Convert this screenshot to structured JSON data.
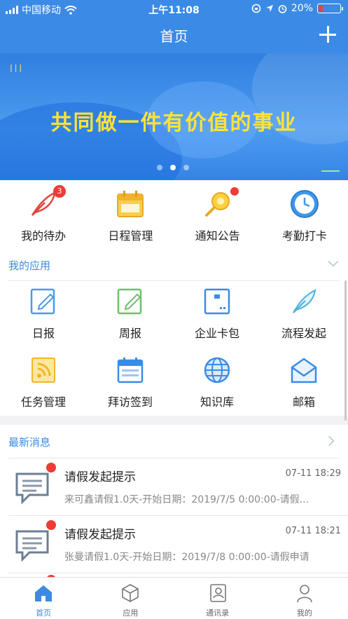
{
  "status_bar": {
    "carrier": "中国移动",
    "time": "上午11:08",
    "battery": "20%",
    "battery_level": 0.2
  },
  "header": {
    "title": "首页",
    "add_icon": "plus-icon"
  },
  "banner": {
    "mark": "||| ",
    "slogan": "共同做一件有价值的事业",
    "page_count": 3,
    "active_page": 2
  },
  "shortcuts": [
    {
      "label": "我的待办",
      "icon": "feather-quill-icon",
      "badge": "3"
    },
    {
      "label": "日程管理",
      "icon": "calendar-icon"
    },
    {
      "label": "通知公告",
      "icon": "megaphone-icon",
      "dot": true
    },
    {
      "label": "考勤打卡",
      "icon": "clock-icon"
    }
  ],
  "my_apps": {
    "title": "我的应用",
    "items": [
      {
        "label": "日报",
        "icon": "edit-note-icon"
      },
      {
        "label": "周报",
        "icon": "edit-note-icon"
      },
      {
        "label": "企业卡包",
        "icon": "card-box-icon"
      },
      {
        "label": "流程发起",
        "icon": "quill-icon"
      },
      {
        "label": "任务管理",
        "icon": "task-rss-icon"
      },
      {
        "label": "拜访签到",
        "icon": "calendar-icon"
      },
      {
        "label": "知识库",
        "icon": "globe-icon"
      },
      {
        "label": "邮箱",
        "icon": "mail-icon"
      }
    ]
  },
  "news": {
    "title": "最新消息",
    "messages": [
      {
        "title": "请假发起提示",
        "time": "07-11 18:29",
        "summary": "来可鑫请假1.0天-开始日期：2019/7/5 0:00:00-请假..."
      },
      {
        "title": "请假发起提示",
        "time": "07-11 18:21",
        "summary": "张曼请假1.0天-开始日期：2019/7/8 0:00:00-请假申请"
      }
    ]
  },
  "tabs": [
    {
      "label": "首页",
      "icon": "home-icon",
      "active": true
    },
    {
      "label": "应用",
      "icon": "cube-icon"
    },
    {
      "label": "通讯录",
      "icon": "contacts-icon"
    },
    {
      "label": "我的",
      "icon": "person-icon"
    }
  ],
  "colors": {
    "primary": "#3b8be6",
    "accent_text": "#3a8be3",
    "badge": "#ed3b36",
    "slogan": "#ffe33a"
  }
}
